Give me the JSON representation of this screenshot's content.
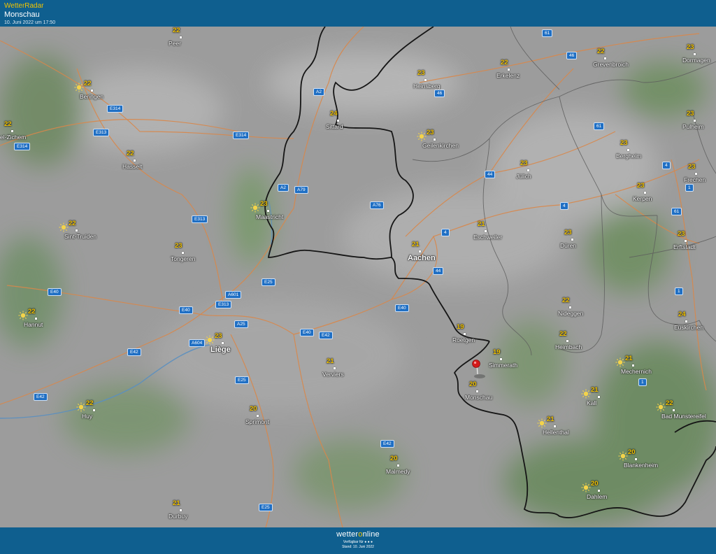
{
  "header": {
    "brand": "WetterRadar",
    "location": "Monschau",
    "timestamp": "10. Juni 2022 um 17:50"
  },
  "footer": {
    "logo_a": "wetter",
    "logo_b": "o",
    "logo_c": "nline",
    "availability": "Verfügbar für",
    "stand": "Stand: 10. Juni 2022"
  },
  "map": {
    "cities": [
      {
        "id": "peer",
        "name": "Peer",
        "temp": "22",
        "sun": false
      },
      {
        "id": "beringen",
        "name": "Beringen",
        "temp": "22",
        "sun": true
      },
      {
        "id": "zichem",
        "name": "el-Zichem",
        "temp": "22",
        "sun": false
      },
      {
        "id": "hasselt",
        "name": "Hasselt",
        "temp": "22",
        "sun": false
      },
      {
        "id": "sint-truiden",
        "name": "Sint-Truiden",
        "temp": "22",
        "sun": true
      },
      {
        "id": "tongeren",
        "name": "Tongeren",
        "temp": "23",
        "sun": false
      },
      {
        "id": "maastricht",
        "name": "Maastricht",
        "temp": "23",
        "sun": true
      },
      {
        "id": "sittard",
        "name": "Sittard",
        "temp": "24",
        "sun": false
      },
      {
        "id": "heinsberg",
        "name": "Heinsberg",
        "temp": "23",
        "sun": false
      },
      {
        "id": "geilenkirchen",
        "name": "Geilenkirchen",
        "temp": "23",
        "sun": true
      },
      {
        "id": "erkelenz",
        "name": "Erkelenz",
        "temp": "22",
        "sun": false
      },
      {
        "id": "grevenbroich",
        "name": "Grevenbroich",
        "temp": "22",
        "sun": false
      },
      {
        "id": "dormagen",
        "name": "Dormagen",
        "temp": "23",
        "sun": false
      },
      {
        "id": "pulheim",
        "name": "Pulheim",
        "temp": "23",
        "sun": false
      },
      {
        "id": "bergheim",
        "name": "Bergheim",
        "temp": "23",
        "sun": false
      },
      {
        "id": "frechen",
        "name": "Frechen",
        "temp": "23",
        "sun": false
      },
      {
        "id": "kerpen",
        "name": "Kerpen",
        "temp": "23",
        "sun": false
      },
      {
        "id": "juelich",
        "name": "Jülich",
        "temp": "23",
        "sun": false
      },
      {
        "id": "eschweiler",
        "name": "Eschweiler",
        "temp": "21",
        "sun": false
      },
      {
        "id": "aachen",
        "name": "Aachen",
        "temp": "21",
        "sun": false
      },
      {
        "id": "dueren",
        "name": "Düren",
        "temp": "23",
        "sun": false
      },
      {
        "id": "erftstadt",
        "name": "Erftstadt",
        "temp": "23",
        "sun": false
      },
      {
        "id": "hannut",
        "name": "Hannut",
        "temp": "22",
        "sun": true
      },
      {
        "id": "liege",
        "name": "Liège",
        "temp": "23",
        "sun": true
      },
      {
        "id": "verviers",
        "name": "Verviers",
        "temp": "21",
        "sun": false
      },
      {
        "id": "roetgen",
        "name": "Roetgen",
        "temp": "19",
        "sun": false
      },
      {
        "id": "simmerath",
        "name": "Simmerath",
        "temp": "19",
        "sun": false
      },
      {
        "id": "monschau",
        "name": "Monschau",
        "temp": "20",
        "sun": false
      },
      {
        "id": "nideggen",
        "name": "Nideggen",
        "temp": "22",
        "sun": false
      },
      {
        "id": "heimbach",
        "name": "Heimbach",
        "temp": "22",
        "sun": false
      },
      {
        "id": "mechernich",
        "name": "Mechernich",
        "temp": "21",
        "sun": true
      },
      {
        "id": "euskirchen",
        "name": "Euskirchen",
        "temp": "24",
        "sun": false
      },
      {
        "id": "huy",
        "name": "Huy",
        "temp": "22",
        "sun": true
      },
      {
        "id": "sprimont",
        "name": "Sprimont",
        "temp": "20",
        "sun": false
      },
      {
        "id": "kall",
        "name": "Kall",
        "temp": "21",
        "sun": true
      },
      {
        "id": "bad-muenstereifel",
        "name": "Bad Munstereifel",
        "temp": "22",
        "sun": true
      },
      {
        "id": "hellenthal",
        "name": "Hellenthal",
        "temp": "21",
        "sun": true
      },
      {
        "id": "blankenheim",
        "name": "Blankenheim",
        "temp": "20",
        "sun": true
      },
      {
        "id": "malmedy",
        "name": "Malmedy",
        "temp": "20",
        "sun": false
      },
      {
        "id": "dahlem",
        "name": "Dahlem",
        "temp": "20",
        "sun": true
      },
      {
        "id": "durbuy",
        "name": "Durbuy",
        "temp": "21",
        "sun": false
      }
    ],
    "roads": [
      {
        "id": "a2-north",
        "label": "A2"
      },
      {
        "id": "a2-south",
        "label": "A2"
      },
      {
        "id": "a79",
        "label": "A79"
      },
      {
        "id": "a76",
        "label": "A76"
      },
      {
        "id": "e314-1",
        "label": "E314"
      },
      {
        "id": "e313-1",
        "label": "E313"
      },
      {
        "id": "e314-2",
        "label": "E314"
      },
      {
        "id": "e314-3",
        "label": "E314"
      },
      {
        "id": "e313-2",
        "label": "E313"
      },
      {
        "id": "e40-1",
        "label": "E40"
      },
      {
        "id": "e40-2",
        "label": "E40"
      },
      {
        "id": "e40-3",
        "label": "E40"
      },
      {
        "id": "e40-4",
        "label": "E40"
      },
      {
        "id": "e42-1",
        "label": "E42"
      },
      {
        "id": "e42-2",
        "label": "E42"
      },
      {
        "id": "e42-3",
        "label": "E42"
      },
      {
        "id": "e42-4",
        "label": "E42"
      },
      {
        "id": "a601",
        "label": "A601"
      },
      {
        "id": "e313-3",
        "label": "E313"
      },
      {
        "id": "a25",
        "label": "A25"
      },
      {
        "id": "a604",
        "label": "A604"
      },
      {
        "id": "e25-1",
        "label": "E25"
      },
      {
        "id": "e25-2",
        "label": "E25"
      },
      {
        "id": "e25-3",
        "label": "E25"
      },
      {
        "id": "r4-1",
        "label": "4"
      },
      {
        "id": "r4-2",
        "label": "4"
      },
      {
        "id": "r4-3",
        "label": "4"
      },
      {
        "id": "r44-1",
        "label": "44"
      },
      {
        "id": "r44-2",
        "label": "44"
      },
      {
        "id": "r46-1",
        "label": "46"
      },
      {
        "id": "r46-2",
        "label": "46"
      },
      {
        "id": "r61-1",
        "label": "61"
      },
      {
        "id": "r61-2",
        "label": "61"
      },
      {
        "id": "r61-3",
        "label": "61"
      },
      {
        "id": "r1-1",
        "label": "1"
      },
      {
        "id": "r1-2",
        "label": "1"
      },
      {
        "id": "r1-3",
        "label": "1"
      }
    ]
  }
}
